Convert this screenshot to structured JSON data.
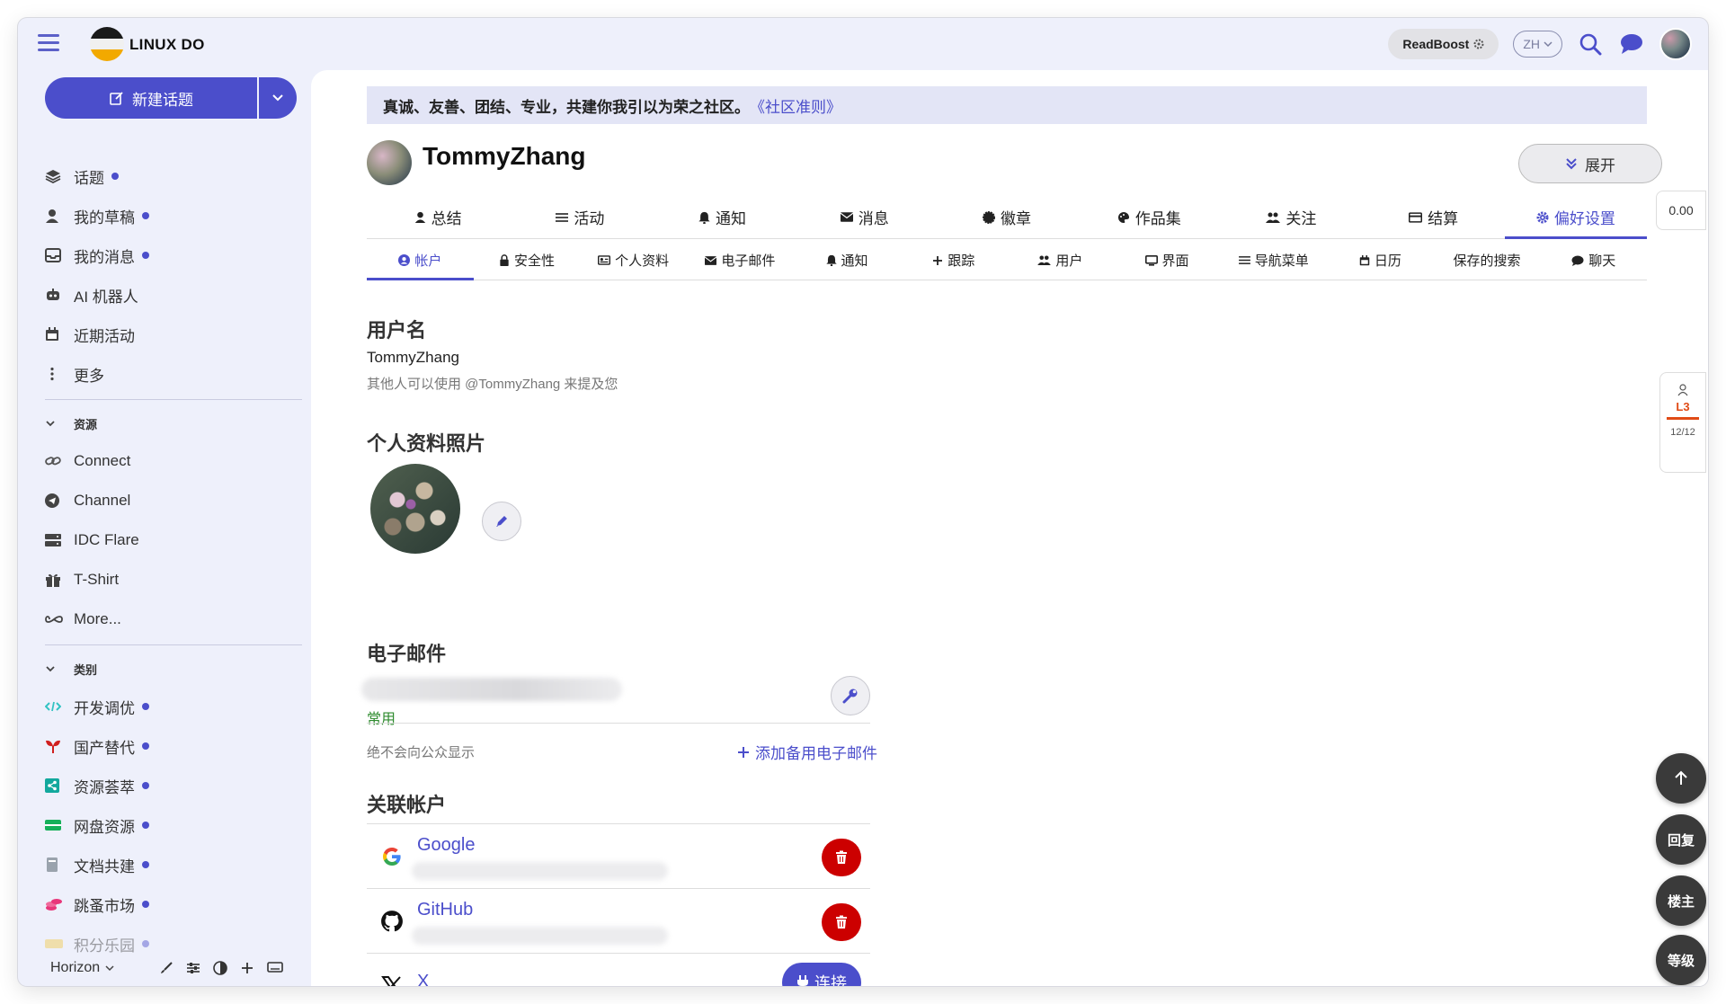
{
  "header": {
    "brand": "LINUX DO",
    "readboost": "ReadBoost",
    "lang": "ZH"
  },
  "sidebar": {
    "new_topic": "新建话题",
    "items": [
      {
        "label": "话题",
        "icon": "layers-icon",
        "dot": true
      },
      {
        "label": "我的草稿",
        "icon": "user-icon",
        "dot": true
      },
      {
        "label": "我的消息",
        "icon": "inbox-icon",
        "dot": true
      },
      {
        "label": "AI 机器人",
        "icon": "robot-icon",
        "dot": false
      },
      {
        "label": "近期活动",
        "icon": "calendar-icon",
        "dot": false
      },
      {
        "label": "更多",
        "icon": "more-vertical-icon",
        "dot": false
      }
    ],
    "resources_title": "资源",
    "resources": [
      {
        "label": "Connect",
        "icon": "link-icon"
      },
      {
        "label": "Channel",
        "icon": "telegram-icon"
      },
      {
        "label": "IDC Flare",
        "icon": "server-icon"
      },
      {
        "label": "T-Shirt",
        "icon": "gift-icon"
      },
      {
        "label": "More...",
        "icon": "infinity-icon"
      }
    ],
    "categories_title": "类别",
    "categories": [
      {
        "label": "开发调优",
        "color": "#32c3c3"
      },
      {
        "label": "国产替代",
        "color": "#d01f1f"
      },
      {
        "label": "资源荟萃",
        "color": "#12a89d"
      },
      {
        "label": "网盘资源",
        "color": "#16b05a"
      },
      {
        "label": "文档共建",
        "color": "#9aa3ad"
      },
      {
        "label": "跳蚤市场",
        "color": "#e8367a"
      },
      {
        "label": "积分乐园",
        "color": "#f2c94c"
      }
    ],
    "footer_theme": "Horizon"
  },
  "main": {
    "banner_text": "真诚、友善、团结、专业，共建你我引以为荣之社区。",
    "banner_link": "《社区准则》",
    "username": "TommyZhang",
    "expand": "展开",
    "tabs": [
      {
        "label": "总结",
        "icon": "user-icon"
      },
      {
        "label": "活动",
        "icon": "list-icon"
      },
      {
        "label": "通知",
        "icon": "bell-icon"
      },
      {
        "label": "消息",
        "icon": "envelope-icon"
      },
      {
        "label": "徽章",
        "icon": "badge-icon"
      },
      {
        "label": "作品集",
        "icon": "palette-icon"
      },
      {
        "label": "关注",
        "icon": "users-icon"
      },
      {
        "label": "结算",
        "icon": "card-icon"
      },
      {
        "label": "偏好设置",
        "icon": "gear-icon"
      }
    ],
    "subtabs": [
      {
        "label": "帐户",
        "icon": "user-circle-icon"
      },
      {
        "label": "安全性",
        "icon": "lock-icon"
      },
      {
        "label": "个人资料",
        "icon": "id-card-icon"
      },
      {
        "label": "电子邮件",
        "icon": "envelope-icon"
      },
      {
        "label": "通知",
        "icon": "bell-icon"
      },
      {
        "label": "跟踪",
        "icon": "plus-icon"
      },
      {
        "label": "用户",
        "icon": "users-icon"
      },
      {
        "label": "界面",
        "icon": "monitor-icon"
      },
      {
        "label": "导航菜单",
        "icon": "list-icon"
      },
      {
        "label": "日历",
        "icon": "calendar-icon"
      },
      {
        "label": "保存的搜索",
        "icon": ""
      },
      {
        "label": "聊天",
        "icon": "chat-icon"
      }
    ],
    "username_section": {
      "title": "用户名",
      "value": "TommyZhang",
      "hint": "其他人可以使用 @TommyZhang 来提及您"
    },
    "photo_section": {
      "title": "个人资料照片"
    },
    "email_section": {
      "title": "电子邮件",
      "primary_tag": "常用",
      "hint": "绝不会向公众显示",
      "add": "添加备用电子邮件"
    },
    "accounts_section": {
      "title": "关联帐户",
      "accounts": [
        {
          "name": "Google",
          "action": "delete"
        },
        {
          "name": "GitHub",
          "action": "delete"
        },
        {
          "name": "X",
          "action": "connect",
          "connect_label": "连接"
        }
      ]
    }
  },
  "rail": {
    "counter": "0.00",
    "level": "L3",
    "level_progress": "12/12",
    "fab_reply": "回复",
    "fab_op": "楼主",
    "fab_level": "等级"
  },
  "colors": {
    "accent": "#4b4ecb",
    "danger": "#cc0000",
    "success": "#2e8b2e"
  }
}
